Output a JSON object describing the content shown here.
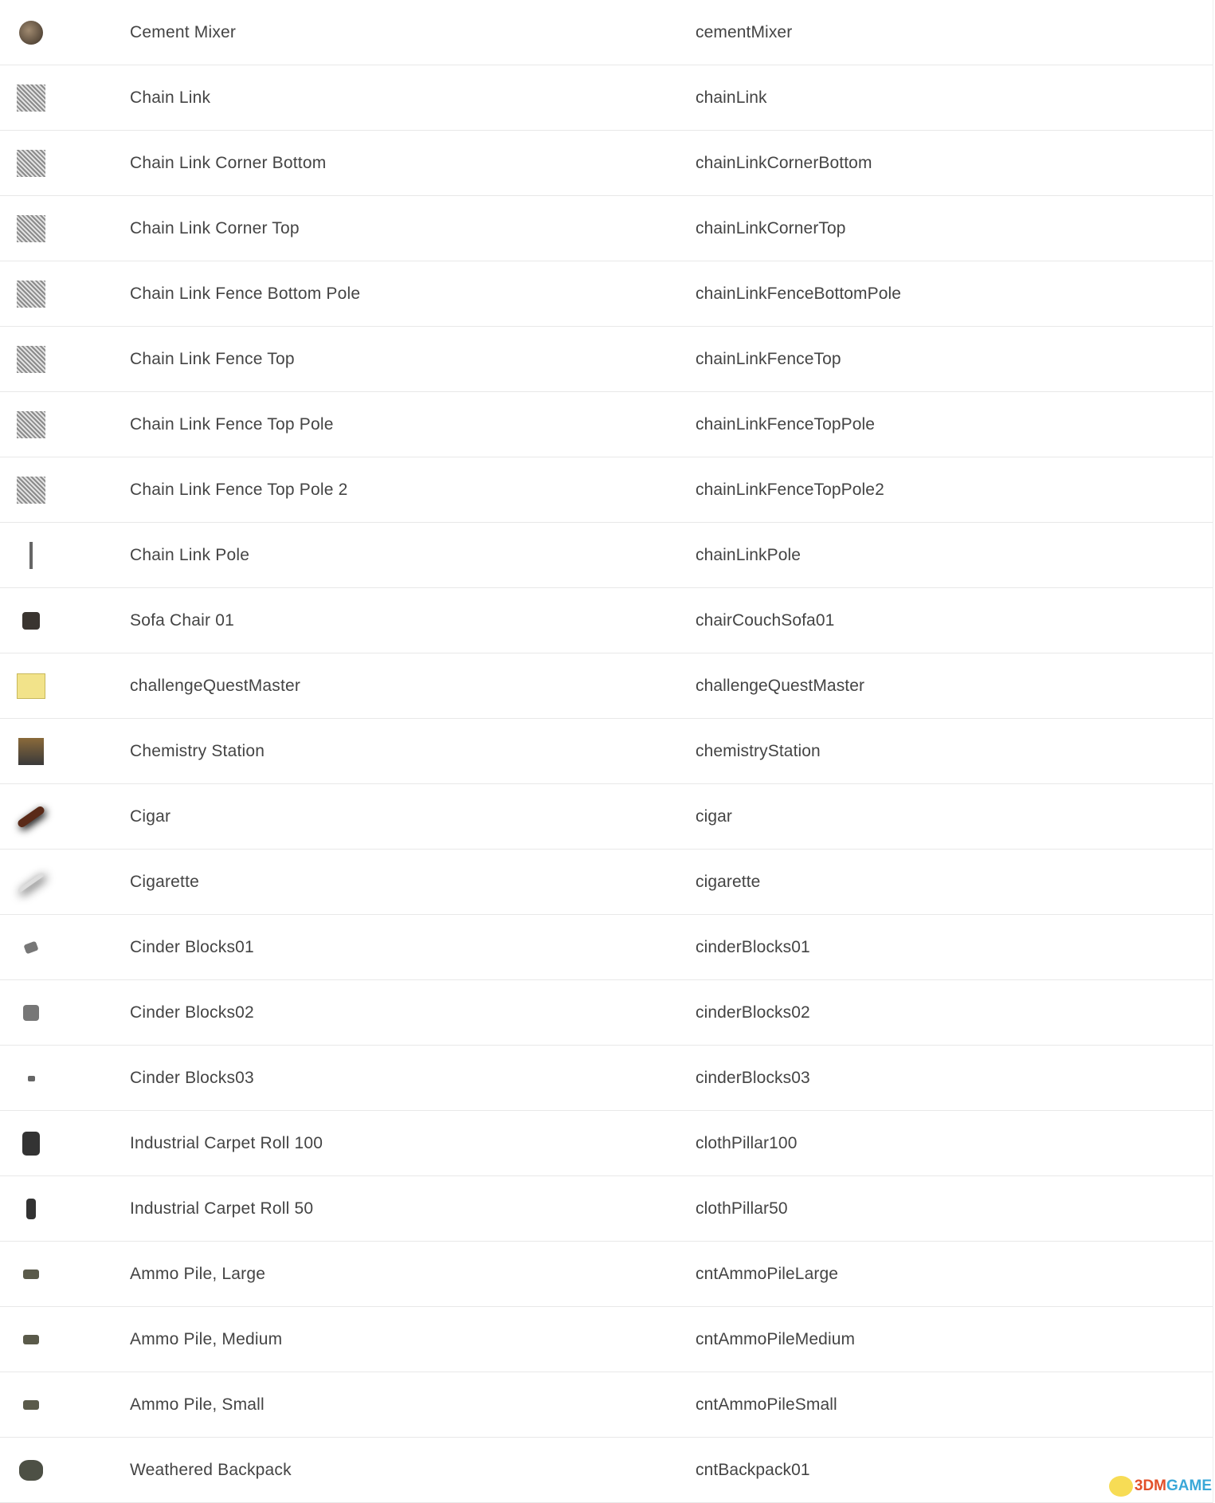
{
  "rows": [
    {
      "icon": "cement-mixer-icon",
      "cls": "i-round",
      "name": "Cement Mixer",
      "code": "cementMixer"
    },
    {
      "icon": "chain-link-icon",
      "cls": "i-fence",
      "name": "Chain Link",
      "code": "chainLink"
    },
    {
      "icon": "chain-link-corner-icon",
      "cls": "i-fence",
      "name": "Chain Link Corner Bottom",
      "code": "chainLinkCornerBottom"
    },
    {
      "icon": "chain-link-corner-icon",
      "cls": "i-fence",
      "name": "Chain Link Corner Top",
      "code": "chainLinkCornerTop"
    },
    {
      "icon": "chain-link-fence-icon",
      "cls": "i-fence",
      "name": "Chain Link Fence Bottom Pole",
      "code": "chainLinkFenceBottomPole"
    },
    {
      "icon": "chain-link-fence-icon",
      "cls": "i-fence",
      "name": "Chain Link Fence Top",
      "code": "chainLinkFenceTop"
    },
    {
      "icon": "chain-link-fence-icon",
      "cls": "i-fence",
      "name": "Chain Link Fence Top Pole",
      "code": "chainLinkFenceTopPole"
    },
    {
      "icon": "chain-link-fence-icon",
      "cls": "i-fence",
      "name": "Chain Link Fence Top Pole 2",
      "code": "chainLinkFenceTopPole2"
    },
    {
      "icon": "pole-icon",
      "cls": "i-pole",
      "name": "Chain Link Pole",
      "code": "chainLinkPole"
    },
    {
      "icon": "sofa-chair-icon",
      "cls": "i-dark",
      "name": "Sofa Chair 01",
      "code": "chairCouchSofa01"
    },
    {
      "icon": "note-paper-icon",
      "cls": "i-paper",
      "name": "challengeQuestMaster",
      "code": "challengeQuestMaster"
    },
    {
      "icon": "chemistry-station-icon",
      "cls": "i-station",
      "name": "Chemistry Station",
      "code": "chemistryStation"
    },
    {
      "icon": "cigar-icon",
      "cls": "i-cigar",
      "name": "Cigar",
      "code": "cigar"
    },
    {
      "icon": "cigarette-icon",
      "cls": "i-cig",
      "name": "Cigarette",
      "code": "cigarette"
    },
    {
      "icon": "cinder-blocks-icon",
      "cls": "i-small",
      "name": "Cinder Blocks01",
      "code": "cinderBlocks01"
    },
    {
      "icon": "cinder-blocks-icon",
      "cls": "i-med",
      "name": "Cinder Blocks02",
      "code": "cinderBlocks02"
    },
    {
      "icon": "cinder-blocks-icon",
      "cls": "i-tiny",
      "name": "Cinder Blocks03",
      "code": "cinderBlocks03"
    },
    {
      "icon": "carpet-roll-icon",
      "cls": "i-drum",
      "name": "Industrial Carpet Roll 100",
      "code": "clothPillar100"
    },
    {
      "icon": "carpet-roll-icon",
      "cls": "i-drum-s",
      "name": "Industrial Carpet Roll 50",
      "code": "clothPillar50"
    },
    {
      "icon": "ammo-pile-icon",
      "cls": "i-ammo",
      "name": "Ammo Pile, Large",
      "code": "cntAmmoPileLarge"
    },
    {
      "icon": "ammo-pile-icon",
      "cls": "i-ammo",
      "name": "Ammo Pile, Medium",
      "code": "cntAmmoPileMedium"
    },
    {
      "icon": "ammo-pile-icon",
      "cls": "i-ammo",
      "name": "Ammo Pile, Small",
      "code": "cntAmmoPileSmall"
    },
    {
      "icon": "backpack-icon",
      "cls": "i-pack",
      "name": "Weathered Backpack",
      "code": "cntBackpack01"
    }
  ],
  "watermark": {
    "part1": "3DM",
    "part2": "GAME"
  }
}
